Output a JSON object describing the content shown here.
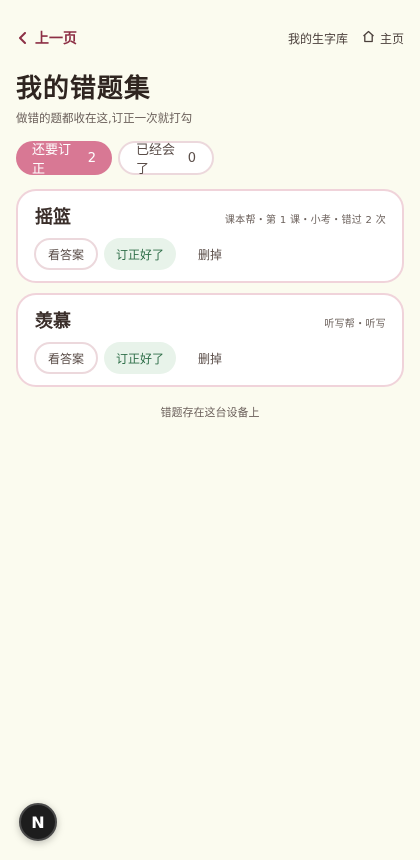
{
  "nav": {
    "back_label": "上一页",
    "my_words_label": "我的生字库",
    "home_label": "主页"
  },
  "page": {
    "title": "我的错题集",
    "subtitle": "做错的题都收在这,订正一次就打勾"
  },
  "tabs": [
    {
      "label": "还要订正",
      "count": "2",
      "active": true
    },
    {
      "label": "已经会了",
      "count": "0",
      "active": false
    }
  ],
  "cards": [
    {
      "word": "摇篮",
      "meta": "课本帮・第 1 课・小考・错过 2 次",
      "actions": {
        "answer": "看答案",
        "fixed": "订正好了",
        "delete": "删掉"
      }
    },
    {
      "word": "羡慕",
      "meta": "听写帮・听写",
      "actions": {
        "answer": "看答案",
        "fixed": "订正好了",
        "delete": "删掉"
      }
    }
  ],
  "footer_note": "错题存在这台设备上",
  "badge": {
    "letter": "N"
  },
  "colors": {
    "background": "#fbfbef",
    "accent_pink": "#d87894",
    "back_link": "#8c2f45",
    "success_green": "#2f6f49"
  },
  "icons": {
    "back": "chevron-left-icon",
    "home": "home-icon"
  }
}
